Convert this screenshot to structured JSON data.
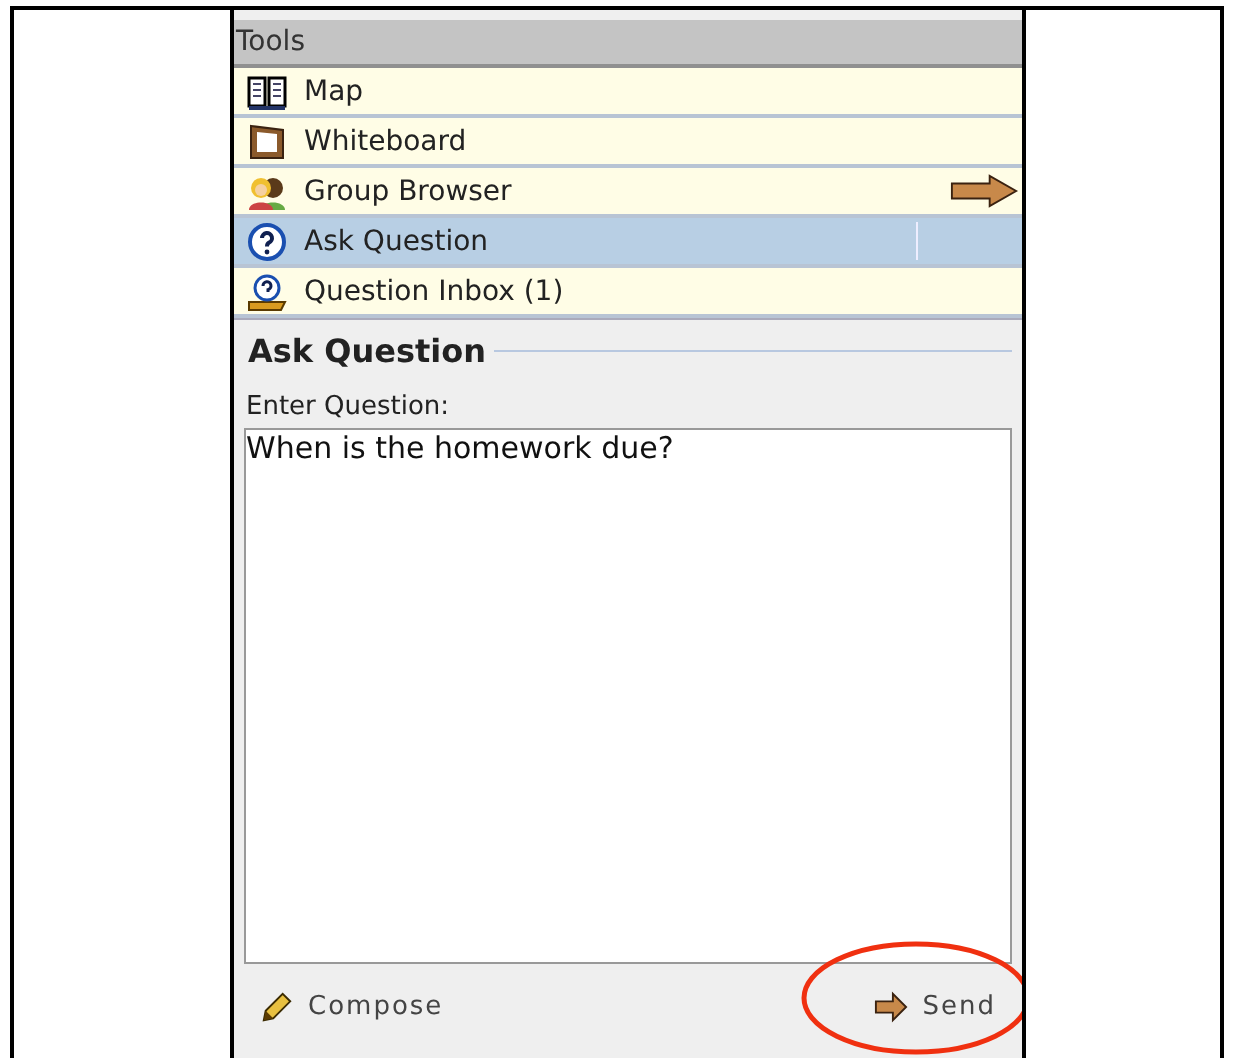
{
  "tools": {
    "title": "Tools",
    "items": [
      {
        "label": "Map",
        "selected": false,
        "arrow": false
      },
      {
        "label": "Whiteboard",
        "selected": false,
        "arrow": false
      },
      {
        "label": "Group Browser",
        "selected": false,
        "arrow": true
      },
      {
        "label": "Ask Question",
        "selected": true,
        "arrow": false
      },
      {
        "label": "Question Inbox (1)",
        "selected": false,
        "arrow": false
      }
    ]
  },
  "form": {
    "title": "Ask Question",
    "label": "Enter Question:",
    "value": "When is the homework due?"
  },
  "footer": {
    "compose": "Compose",
    "send": "Send"
  }
}
